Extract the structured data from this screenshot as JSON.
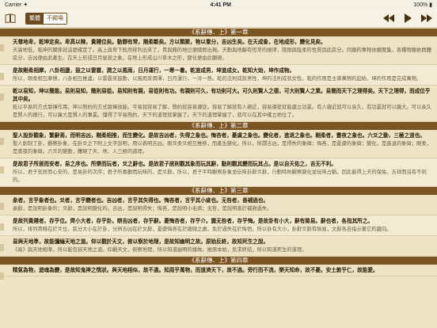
{
  "status": {
    "carrier": "Carrier",
    "wifi": "✦",
    "time": "4:41 PM",
    "battery_pct": "100%"
  },
  "toolbar": {
    "seg_active": "繁體",
    "seg_inactive": "不顯場",
    "icons": {
      "menu": "book-icon",
      "prev": "rewind-icon",
      "play": "play-icon",
      "next": "fast-forward-icon"
    }
  },
  "chapters": [
    {
      "title": "《系辭傳．上》第一章",
      "blocks": [
        {
          "orig": "天尊地卑，乾坤定矣。卑高以陳，貴賤位矣。動靜有常，剛柔斷矣。方以類聚，物以羣分，吉凶生矣。在天成象，在地成形，變化見矣。",
          "trans": "天高地低，乾坤的關係就這麼確定了。高上與卑下既然排列出來了，貴與賤的地位便隨即出現。天動與地靜有恆常的規律，陽剛與陰柔的性質因此區分。同類的事物依類聚集，各種物類依群體區分，吉凶便由此產生。在天上形成日月星辰之象，在地上形成山川草木之形，變化便由此顯現。"
        },
        {
          "orig": "是故剛柔相摩，八卦相盪，鼓之以雷霆，潤之以風雨，日月運行，一寒一暑。乾道成男，坤道成女。乾知大始，坤作成物。",
          "trans": "所以，剛柔相互摩擦，八卦相互推盪。以雷霆來鼓動，以風雨來潤澤，日月運行，一冷一熱。乾的法則成就男性，坤的法則成就女性。乾的作用是主導萬物的起始，坤的作用是完成萬物。"
        },
        {
          "orig": "乾以易知，坤以簡能。易則易知，簡則易從。易知則有親，易從則有功。有親則可久，有功則可大。可久則賢人之德，可大則賢人之業。易簡而天下之理得矣。天下之理得，而成位乎其中矣。",
          "trans": "乾以平易的方式發揮作用，坤以簡約的方式發揮效能。平易就容易了解，簡約就容易遵從。容易了解就有人親近，容易遵從就能建立功業。有人親近就可以長久，有功業就可以廣大。可以長久是賢人的德行，可以廣大是賢人的事業。懂得了平易簡約，天下的道理就掌握了。天下的道理掌握了，就可以在其中確立地位了。"
        }
      ]
    },
    {
      "title": "《系辭傳．上》第二章",
      "blocks": [
        {
          "orig": "聖人設卦觀象，繫辭焉，而明吉凶，剛柔相推，而生變化。是故吉凶者，失得之象也。悔吝者，憂虞之象也。變化者，進退之象也。剛柔者，晝夜之象也。六爻之動，三極之道也。",
          "trans": "聖人創制了卦，觀察卦象，在卦爻之下附上文字說明，用以表明吉凶。剛爻柔爻相互推移，而產生變化。所以，所謂吉凶，是得失的象徵；悔吝，是憂慮的象徵；變化，是進退的象徵；剛柔，是晝夜的象徵。六爻的變動，體現了天、地、人三極的道理。"
        },
        {
          "orig": "是故君子所居而安者，易之序也。所樂而玩者，爻之辭也。是故君子居則觀其象而玩其辭，動則觀其變而玩其占。是以自天佑之，吉无不利。",
          "trans": "所以，君子安居而心安的，是易卦的次序；君子所喜歡而玩味的，是爻辭。所以，君子平時觀察卦象並玩味卦辭爻辭，行動時則觀察變化並玩味占斷。因此能得上天的保佑，吉祥而沒有不利的。"
        }
      ]
    },
    {
      "title": "《系辭傳．上》第三章",
      "blocks": [
        {
          "orig": "彖者，言乎象者也。爻者，言乎變者也。吉凶者，言乎其失得也。悔吝者，言乎其小疵也。无咎者，善補過也。",
          "trans": "彖辭，是說明卦象的；爻辭，是說明變化的。吉凶，是說明得失；悔吝，是說明小毛病；无咎，是說明善於補救過失。"
        },
        {
          "orig": "是故列貴賤者，存乎位。齊小大者，存乎卦。辯吉凶者，存乎辭。憂悔吝者，存乎介。震无咎者，存乎悔。是故卦有小大，辭有險易。辭也者，各指其所之。",
          "trans": "所以，排列貴賤在於爻位，區分大小在於卦，分辨吉凶在於文辭，憂慮悔吝在於細微之處，免於過失在於悔悟。所以卦有大小，卦辭爻辭有險易，文辭各自指示著它的趨向。"
        },
        {
          "orig": "易與天地準，故能彌綸天地之道。仰以觀於天文，俯以察於地理，是故知幽明之故。原始反終，故知死生之說。",
          "trans": "《易》與天地相準，所以能包容天地之道。仰觀天文，俯察地理，所以知道幽明的緣故。推原本始，反求終結，所以知道死生的道理。"
        }
      ]
    },
    {
      "title": "《系辭傳．上》第四章",
      "blocks": [
        {
          "orig": "精氣為物，遊魂為變，是故知鬼神之情狀。與天地相似，故不違。知周乎萬物，而道濟天下，故不過。旁行而不流，樂天知命，故不憂。安土敦乎仁，故能愛。",
          "trans": ""
        }
      ]
    }
  ]
}
